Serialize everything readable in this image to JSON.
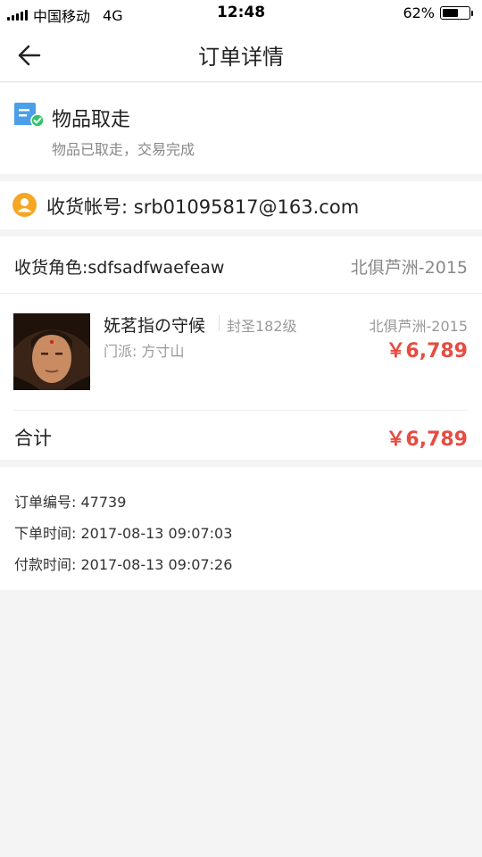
{
  "status_bar": {
    "carrier": "中国移动",
    "network": "4G",
    "time": "12:48",
    "battery": "62%",
    "battery_level": 0.62
  },
  "nav": {
    "title": "订单详情",
    "back_icon": "arrow-left-icon"
  },
  "order_status": {
    "icon": "receipt-check-icon",
    "title": "物品取走",
    "subtitle": "物品已取走，交易完成"
  },
  "account": {
    "icon": "user-circle-icon",
    "text": "收货帐号: srb01095817@163.com"
  },
  "order": {
    "role_label": "收货角色:sdfsadfwaefeaw",
    "role_server": "北俱芦洲-2015",
    "item": {
      "name": "妩茗指の守候",
      "level": "封圣182级",
      "school": "门派: 方寸山",
      "server": "北俱芦洲-2015",
      "price": "￥6,789"
    },
    "total_label": "合计",
    "total_price": "￥6,789"
  },
  "info": {
    "order_no": "订单编号: 47739",
    "order_time": "下单时间: 2017-08-13 09:07:03",
    "pay_time": "付款时间: 2017-08-13 09:07:26"
  },
  "colors": {
    "accent_blue": "#4a9fe8",
    "check_green": "#35c26b",
    "user_orange": "#f5a623",
    "price_red": "#e54d42"
  }
}
